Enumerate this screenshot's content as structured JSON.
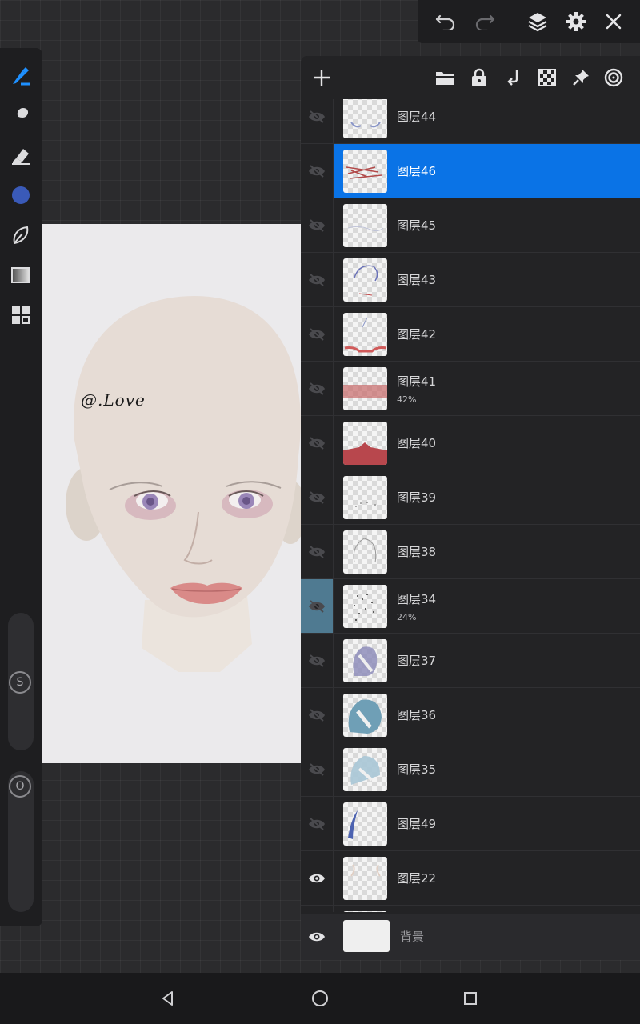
{
  "app": {
    "accent": "#0a73e6",
    "selected_brush_color": "#3a5ab8"
  },
  "topbar": {
    "icons": [
      "undo-icon",
      "redo-icon",
      "layers-icon",
      "gear-icon",
      "close-icon"
    ]
  },
  "left_toolbar": {
    "tools": [
      "brush-icon",
      "smudge-icon",
      "eraser-icon",
      "color-swatch",
      "lasso-icon",
      "gradient-icon",
      "grid-icon"
    ],
    "size_slider_label": "S",
    "opacity_slider_label": "O"
  },
  "canvas": {
    "watermark": "@.Love"
  },
  "layers_panel": {
    "header_icons": [
      "add-icon",
      "folder-icon",
      "lock-icon",
      "merge-down-icon",
      "alpha-lock-icon",
      "pin-icon",
      "target-icon"
    ],
    "layers": [
      {
        "name": "图层44",
        "opacity": "",
        "visible": false,
        "selected": false,
        "clip": false
      },
      {
        "name": "图层46",
        "opacity": "",
        "visible": false,
        "selected": true,
        "clip": false
      },
      {
        "name": "图层45",
        "opacity": "",
        "visible": false,
        "selected": false,
        "clip": false
      },
      {
        "name": "图层43",
        "opacity": "",
        "visible": false,
        "selected": false,
        "clip": false
      },
      {
        "name": "图层42",
        "opacity": "",
        "visible": false,
        "selected": false,
        "clip": false
      },
      {
        "name": "图层41",
        "opacity": "42%",
        "visible": false,
        "selected": false,
        "clip": false
      },
      {
        "name": "图层40",
        "opacity": "",
        "visible": false,
        "selected": false,
        "clip": false
      },
      {
        "name": "图层39",
        "opacity": "",
        "visible": false,
        "selected": false,
        "clip": false
      },
      {
        "name": "图层38",
        "opacity": "",
        "visible": false,
        "selected": false,
        "clip": false
      },
      {
        "name": "图层34",
        "opacity": "24%",
        "visible": false,
        "selected": false,
        "clip": true
      },
      {
        "name": "图层37",
        "opacity": "",
        "visible": false,
        "selected": false,
        "clip": false
      },
      {
        "name": "图层36",
        "opacity": "",
        "visible": false,
        "selected": false,
        "clip": false
      },
      {
        "name": "图层35",
        "opacity": "",
        "visible": false,
        "selected": false,
        "clip": false
      },
      {
        "name": "图层49",
        "opacity": "",
        "visible": false,
        "selected": false,
        "clip": false
      },
      {
        "name": "图层22",
        "opacity": "",
        "visible": true,
        "selected": false,
        "clip": false
      }
    ],
    "background_layer": {
      "name": "背景",
      "visible": true
    }
  },
  "navbar": {
    "icons": [
      "back-icon",
      "home-icon",
      "recents-icon"
    ]
  }
}
